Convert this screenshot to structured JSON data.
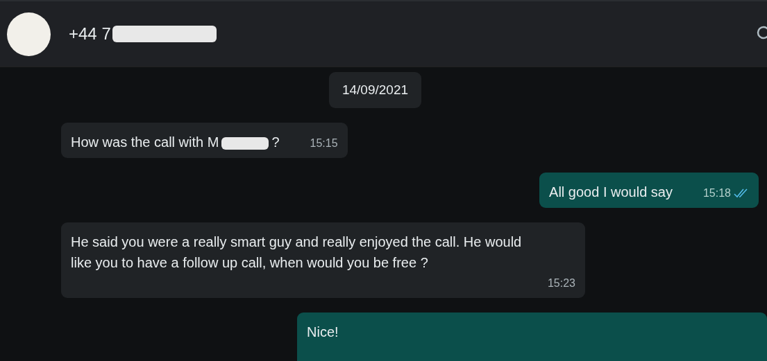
{
  "header": {
    "title_parts": [
      {
        "kind": "text",
        "text": "+44 7"
      },
      {
        "kind": "redacted"
      }
    ]
  },
  "date_chip": "14/09/2021",
  "messages": [
    {
      "kind": "incoming",
      "parts": [
        {
          "kind": "text",
          "text": "How was the call with M"
        },
        {
          "kind": "redacted"
        },
        {
          "kind": "text",
          "text": "?"
        }
      ],
      "time": "15:15"
    },
    {
      "kind": "outgoing",
      "parts": [
        {
          "kind": "text",
          "text": "All good I would say"
        }
      ],
      "time": "15:18",
      "read": true
    },
    {
      "kind": "incoming",
      "parts": [
        {
          "kind": "text",
          "text": "He said you were a really smart guy and really enjoyed the call. He would like you to have a follow up call, when would you be free ?"
        }
      ],
      "time": "15:23"
    },
    {
      "kind": "outgoing",
      "parts": [
        {
          "kind": "text",
          "text": "Nice!"
        }
      ]
    }
  ]
}
